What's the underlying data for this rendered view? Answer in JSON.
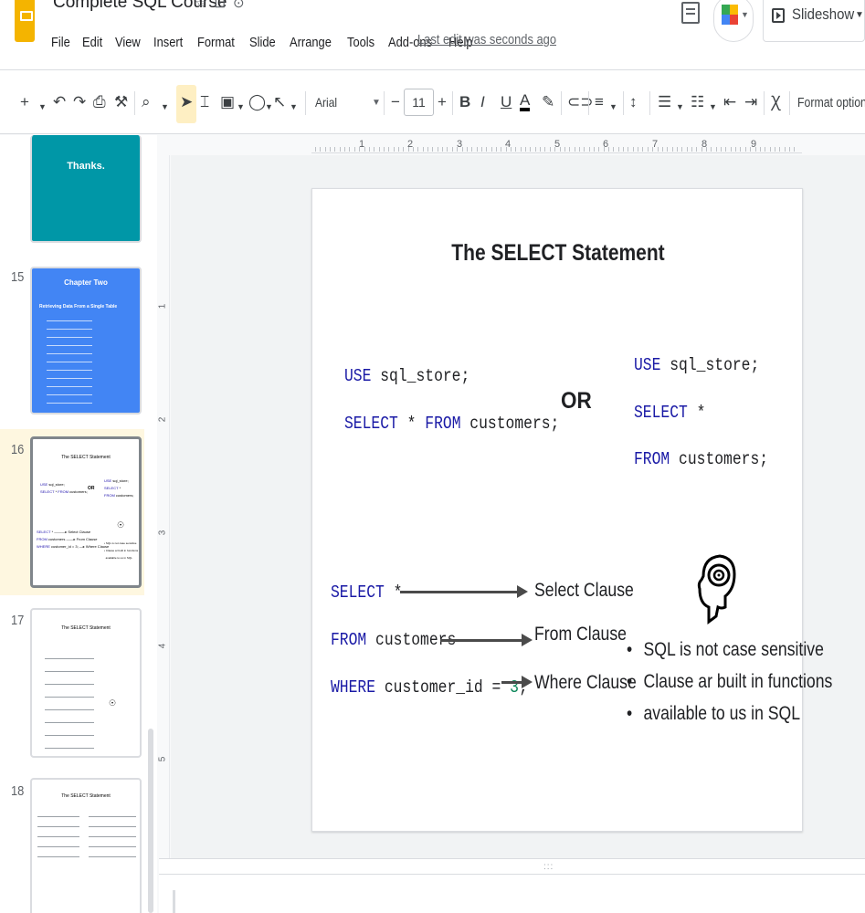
{
  "header": {
    "title": "Complete SQL Course",
    "title_icons": [
      "star-icon",
      "move-to-folder-icon",
      "cloud-status-icon"
    ],
    "menu": [
      "File",
      "Edit",
      "View",
      "Insert",
      "Format",
      "Slide",
      "Arrange",
      "Tools",
      "Add-ons",
      "Help"
    ],
    "last_edit": "Last edit was seconds ago",
    "slideshow_label": "Slideshow"
  },
  "toolbar": {
    "font_name": "Arial",
    "font_size": "11",
    "bold": "B",
    "italic": "I",
    "underline": "U",
    "text_color": "A",
    "format_options": "Format options"
  },
  "filmstrip": {
    "slides": [
      {
        "number": "",
        "title": "Thanks."
      },
      {
        "number": "15",
        "title": "Chapter Two",
        "subtitle": "Retrieving Data From a Single Table"
      },
      {
        "number": "16",
        "title": "The SELECT Statement"
      },
      {
        "number": "17",
        "title": "The SELECT Statement"
      },
      {
        "number": "18",
        "title": "The SELECT Statement"
      }
    ]
  },
  "ruler": {
    "top": [
      "1",
      "2",
      "3",
      "4",
      "5",
      "6",
      "7",
      "8",
      "9"
    ],
    "left": [
      "1",
      "2",
      "3",
      "4",
      "5"
    ]
  },
  "slide": {
    "title": "The SELECT Statement",
    "left_code": {
      "line1_kw": "USE",
      "line1_rest": " sql_store;",
      "line2_kw1": "SELECT",
      "line2_mid": " * ",
      "line2_kw2": "FROM",
      "line2_rest": " customers;"
    },
    "or_label": "OR",
    "right_code": {
      "line1_kw": "USE",
      "line1_rest": " sql_store;",
      "line2_kw": "SELECT",
      "line2_rest": " *",
      "line3_kw": "FROM",
      "line3_rest": " customers;"
    },
    "clauses": {
      "select_kw": "SELECT",
      "select_rest": " *",
      "select_label": "Select Clause",
      "from_kw": "FROM",
      "from_rest": " customers",
      "from_label": "From Clause",
      "where_kw": "WHERE",
      "where_mid": " customer_id = ",
      "where_num": "3",
      "where_end": ";",
      "where_label": "Where Clause"
    },
    "bullets": [
      "SQL is not case sensitive",
      "Clause ar built in functions",
      "available to us in SQL"
    ]
  },
  "colors": {
    "sql_keyword": "#1a1aa6",
    "sql_number": "#098658",
    "slide_teal": "#0097a7",
    "slide_blue": "#4285f4",
    "active_highlight": "#fef7e0",
    "select_tool": "#feefc3"
  }
}
